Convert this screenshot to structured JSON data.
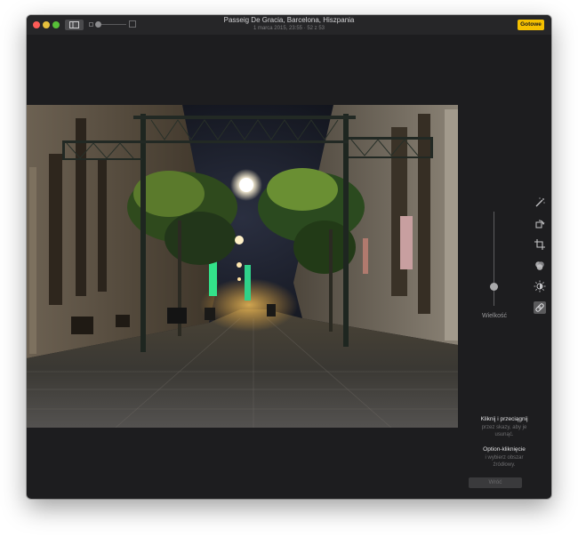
{
  "window": {
    "title": "Passeig De Gracia, Barcelona, Hiszpania",
    "subtitle": "1 marca 2015, 23:55  ·  52 z 53",
    "done_label": "Gotowe"
  },
  "tools": [
    {
      "name": "magic-wand-icon"
    },
    {
      "name": "rotate-icon"
    },
    {
      "name": "crop-icon"
    },
    {
      "name": "filters-icon"
    },
    {
      "name": "adjust-icon"
    },
    {
      "name": "retouch-icon",
      "active": true
    }
  ],
  "retouch": {
    "size_label": "Wielkość",
    "hint1_title": "Kliknij i przeciągnij",
    "hint1_line1": "przez skazy, aby je",
    "hint1_line2": "usunąć.",
    "hint2_title": "Option-kliknięcie",
    "hint2_line1": "i wybierz obszar",
    "hint2_line2": "źródłowy.",
    "revert_label": "Wróć"
  },
  "colors": {
    "accent": "#f5c000",
    "window_bg": "#1d1d1f"
  }
}
